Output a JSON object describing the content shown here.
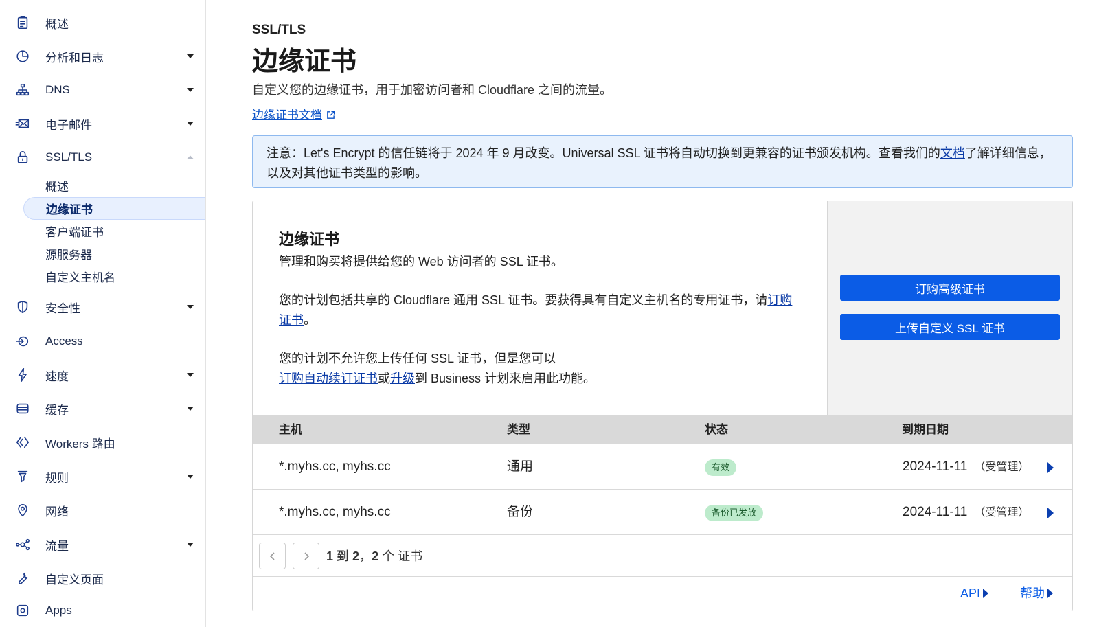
{
  "sidebar": {
    "items": [
      {
        "label": "概述",
        "icon": "clipboard-icon"
      },
      {
        "label": "分析和日志",
        "icon": "pie-chart-icon"
      },
      {
        "label": "DNS",
        "icon": "network-icon"
      },
      {
        "label": "电子邮件",
        "icon": "mail-icon"
      },
      {
        "label": "SSL/TLS",
        "icon": "lock-icon"
      },
      {
        "label": "安全性",
        "icon": "shield-icon"
      },
      {
        "label": "Access",
        "icon": "access-icon"
      },
      {
        "label": "速度",
        "icon": "lightning-icon"
      },
      {
        "label": "缓存",
        "icon": "storage-icon"
      },
      {
        "label": "Workers 路由",
        "icon": "workers-icon"
      },
      {
        "label": "规则",
        "icon": "rules-icon"
      },
      {
        "label": "网络",
        "icon": "location-pin-icon"
      },
      {
        "label": "流量",
        "icon": "traffic-icon"
      },
      {
        "label": "自定义页面",
        "icon": "wrench-icon"
      },
      {
        "label": "Apps",
        "icon": "apps-icon"
      }
    ],
    "ssl_sub": [
      "概述",
      "边缘证书",
      "客户端证书",
      "源服务器",
      "自定义主机名"
    ]
  },
  "page": {
    "breadcrumb": "SSL/TLS",
    "title": "边缘证书",
    "subtitle": "自定义您的边缘证书，用于加密访问者和 Cloudflare 之间的流量。",
    "doc_link": "边缘证书文档"
  },
  "notice": {
    "text_before": "注意：Let's Encrypt 的信任链将于 2024 年 9 月改变。Universal SSL 证书将自动切换到更兼容的证书颁发机构。查看我们的",
    "link": "文档",
    "text_after": "了解详细信息，以及对其他证书类型的影响。"
  },
  "card": {
    "title": "边缘证书",
    "desc": "管理和购买将提供给您的 Web 访问者的 SSL 证书。",
    "p2_text": "您的计划包括共享的 Cloudflare 通用 SSL 证书。要获得具有自定义主机名的专用证书，请",
    "p2_link": "订购证书",
    "p2_end": "。",
    "p3_text": "您的计划不允许您上传任何 SSL 证书，但是您可以",
    "p3_link1": "订购自动续订证书",
    "p3_mid": "或",
    "p3_link2": "升级",
    "p3_end": "到 Business 计划来启用此功能。",
    "btn_order": "订购高级证书",
    "btn_upload": "上传自定义 SSL 证书"
  },
  "table": {
    "headers": [
      "主机",
      "类型",
      "状态",
      "到期日期"
    ],
    "rows": [
      {
        "host": "*.myhs.cc, myhs.cc",
        "type": "通用",
        "status": "有效",
        "expiry": "2024-11-11",
        "managed": "（受管理）"
      },
      {
        "host": "*.myhs.cc, myhs.cc",
        "type": "备份",
        "status": "备份已发放",
        "expiry": "2024-11-11",
        "managed": "（受管理）"
      }
    ]
  },
  "pagination": {
    "from": "1",
    "to_word": "到",
    "to": "2",
    "sep": "，",
    "total": "2",
    "unit": "个 证书"
  },
  "footer": {
    "api": "API",
    "help": "帮助"
  }
}
